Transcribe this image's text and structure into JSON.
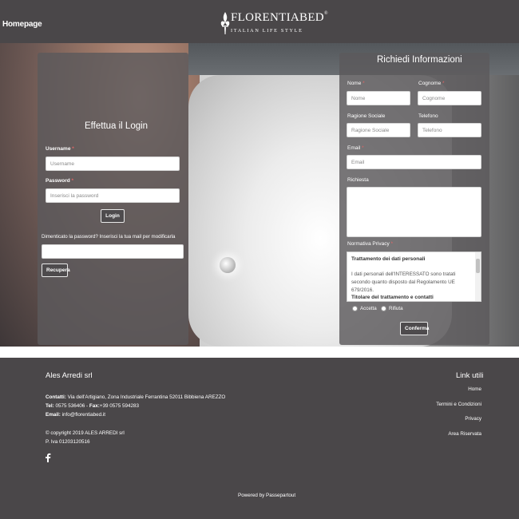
{
  "header": {
    "home_link": "Homepage",
    "logo_main": "FLORENTIABED",
    "logo_reg": "®",
    "logo_sub": "ITALIAN LIFE STYLE"
  },
  "login": {
    "title": "Effettua il Login",
    "username_label": "Username",
    "username_placeholder": "Username",
    "password_label": "Password",
    "password_placeholder": "Inserisci la password",
    "login_button": "Login",
    "forgot_text": "Dimenticato la password? Inserisci la tua mail per modificarla",
    "recover_button": "Recupera",
    "required_mark": "*"
  },
  "info": {
    "title": "Richiedi Informazioni",
    "nome_label": "Nome",
    "nome_placeholder": "Nome",
    "cognome_label": "Cognome",
    "cognome_placeholder": "Cognome",
    "ragione_label": "Ragione Sociale",
    "ragione_placeholder": "Ragione Sociale",
    "telefono_label": "Telefono",
    "telefono_placeholder": "Telefono",
    "email_label": "Email",
    "email_placeholder": "Email",
    "richiesta_label": "Richiesta",
    "privacy_label": "Normativa Privacy",
    "privacy_title": "Trattamento dei dati personali",
    "privacy_body": "I dati personali dell'INTERESSATO sono tratati secondo quanto disposto dal Regolamento UE 679/2016.",
    "privacy_title2": "Titolare del trattamento e contatti",
    "accept_label": "Accetta",
    "reject_label": "Rifiuta",
    "confirm_button": "Conferma",
    "required_mark": "*"
  },
  "footer": {
    "company": "Ales Arredi srl",
    "contacts_label": "Contatti:",
    "contacts_value": " Via dell'Artigiano, Zona Industriale Ferrantina 52011 Bibbiena AREZZO",
    "tel_label": "Tel:",
    "tel_value": " 0575 536406",
    "sep": " - ",
    "fax_label": "Fax:",
    "fax_value": "+39 0575 594283",
    "email_label": "Email:",
    "email_value": " info@florentiabed.it",
    "copyright": "© copyright 2019 ALES ARREDI srl",
    "piva": "P. Iva 01203120516",
    "links_title": "Link utili",
    "links": [
      "Home",
      "Termini e Condizioni",
      "Privacy",
      "Area Riservata"
    ],
    "powered": "Powered by Passepartout"
  },
  "colors": {
    "header_bg": "#4a4749",
    "panel_bg": "#5c595c",
    "required": "#e06666"
  }
}
